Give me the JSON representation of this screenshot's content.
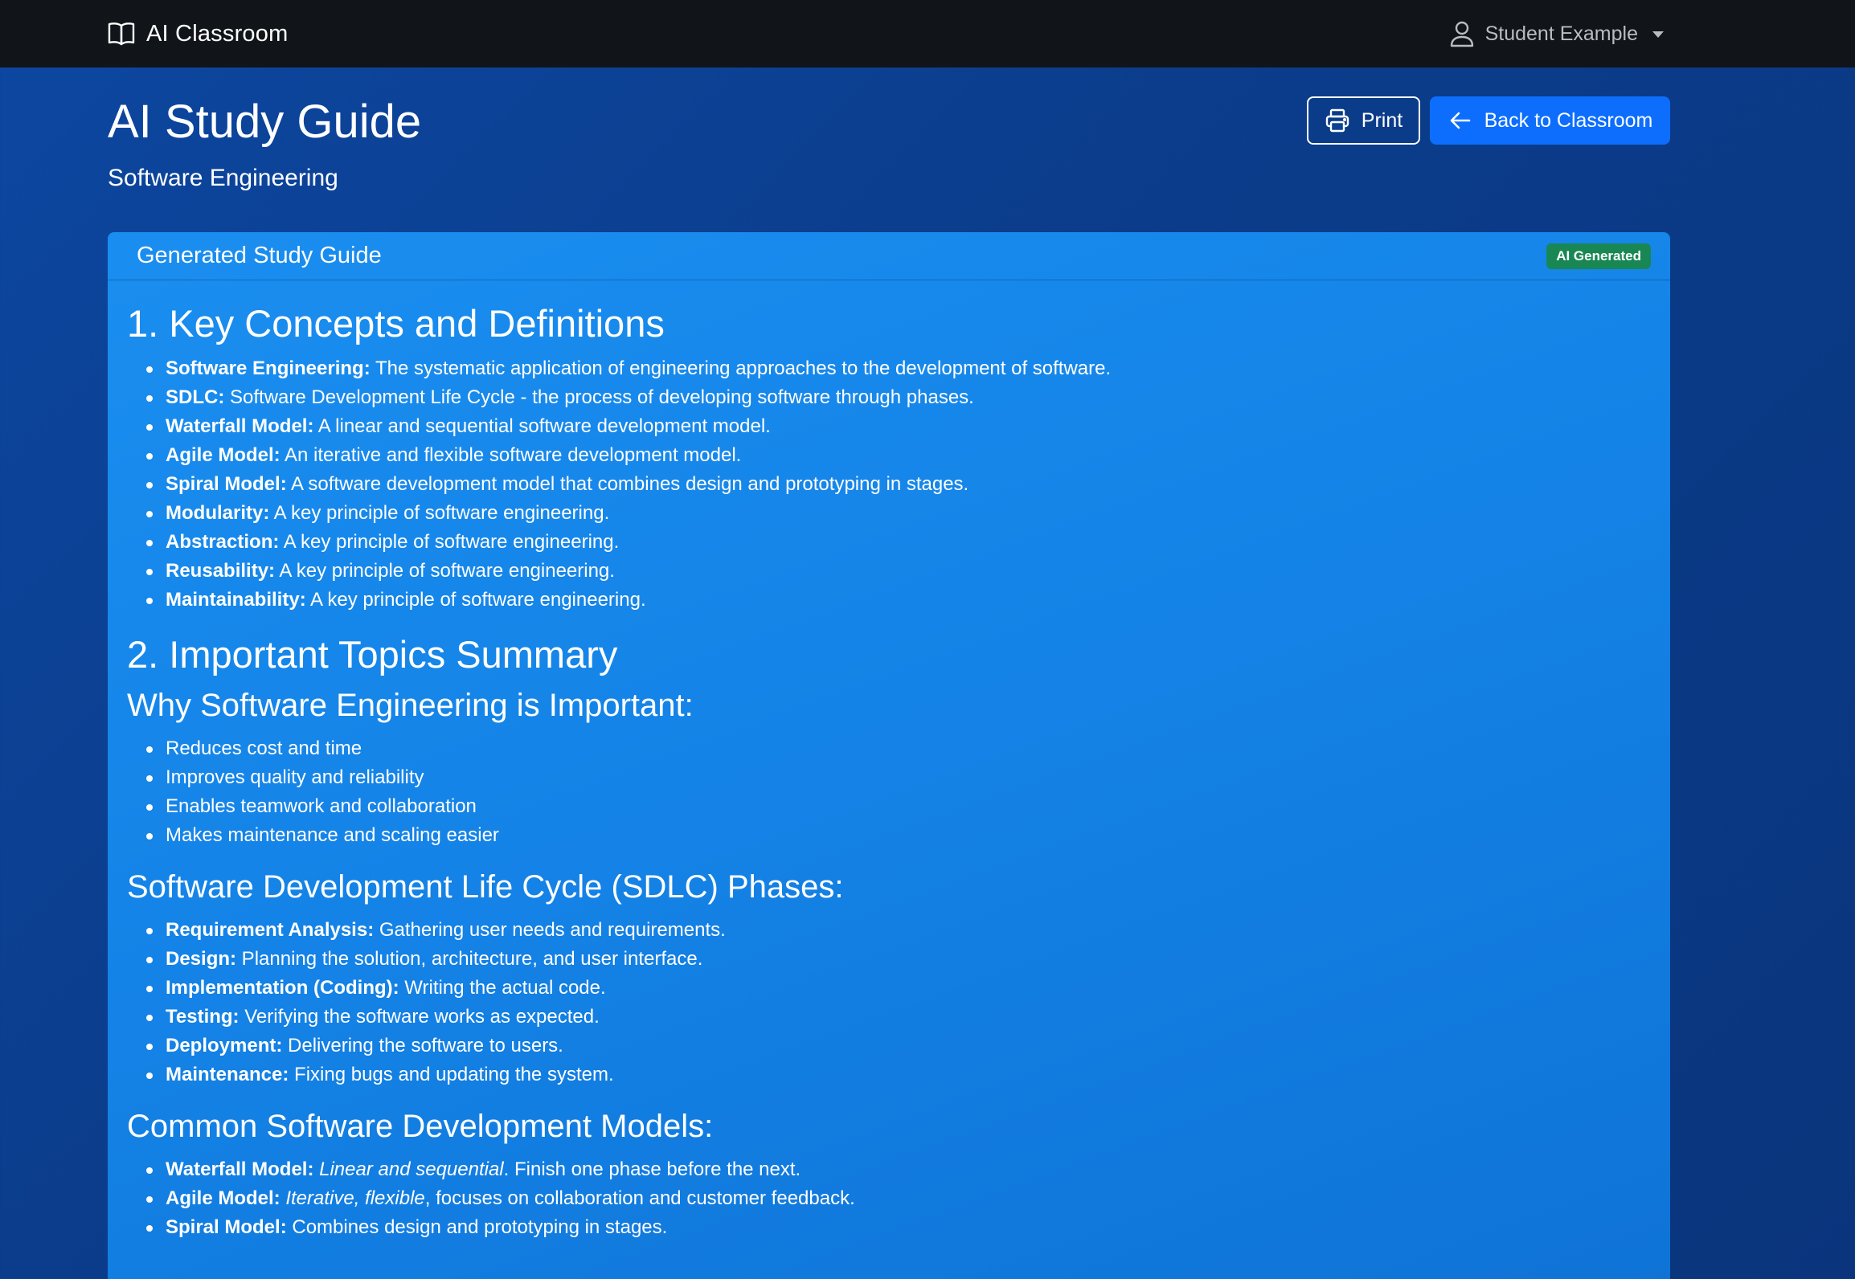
{
  "navbar": {
    "brand": "AI Classroom",
    "user": "Student Example",
    "icons": {
      "brand": "book-icon",
      "user": "user-icon",
      "caret": "caret-down-icon"
    }
  },
  "header": {
    "title": "AI Study Guide",
    "subtitle": "Software Engineering",
    "print_label": "Print",
    "back_label": "Back to Classroom"
  },
  "card": {
    "title": "Generated Study Guide",
    "badge": "AI Generated",
    "section1": {
      "heading": "1. Key Concepts and Definitions",
      "items": [
        {
          "term": "Software Engineering:",
          "text": " The systematic application of engineering approaches to the development of software."
        },
        {
          "term": "SDLC:",
          "text": " Software Development Life Cycle - the process of developing software through phases."
        },
        {
          "term": "Waterfall Model:",
          "text": " A linear and sequential software development model."
        },
        {
          "term": "Agile Model:",
          "text": " An iterative and flexible software development model."
        },
        {
          "term": "Spiral Model:",
          "text": " A software development model that combines design and prototyping in stages."
        },
        {
          "term": "Modularity:",
          "text": " A key principle of software engineering."
        },
        {
          "term": "Abstraction:",
          "text": " A key principle of software engineering."
        },
        {
          "term": "Reusability:",
          "text": " A key principle of software engineering."
        },
        {
          "term": "Maintainability:",
          "text": " A key principle of software engineering."
        }
      ]
    },
    "section2": {
      "heading": "2. Important Topics Summary",
      "why": {
        "heading": "Why Software Engineering is Important:",
        "items": [
          "Reduces cost and time",
          "Improves quality and reliability",
          "Enables teamwork and collaboration",
          "Makes maintenance and scaling easier"
        ]
      },
      "sdlc": {
        "heading": "Software Development Life Cycle (SDLC) Phases:",
        "items": [
          {
            "term": "Requirement Analysis:",
            "text": " Gathering user needs and requirements."
          },
          {
            "term": "Design:",
            "text": " Planning the solution, architecture, and user interface."
          },
          {
            "term": "Implementation (Coding):",
            "text": " Writing the actual code."
          },
          {
            "term": "Testing:",
            "text": " Verifying the software works as expected."
          },
          {
            "term": "Deployment:",
            "text": " Delivering the software to users."
          },
          {
            "term": "Maintenance:",
            "text": " Fixing bugs and updating the system."
          }
        ]
      },
      "models": {
        "heading": "Common Software Development Models:",
        "items": [
          {
            "term": "Waterfall Model:",
            "em": "Linear and sequential",
            "text": ". Finish one phase before the next."
          },
          {
            "term": "Agile Model:",
            "em": "Iterative, flexible",
            "text": ", focuses on collaboration and customer feedback."
          },
          {
            "term": "Spiral Model:",
            "em": "",
            "text": " Combines design and prototyping in stages."
          }
        ]
      }
    }
  }
}
